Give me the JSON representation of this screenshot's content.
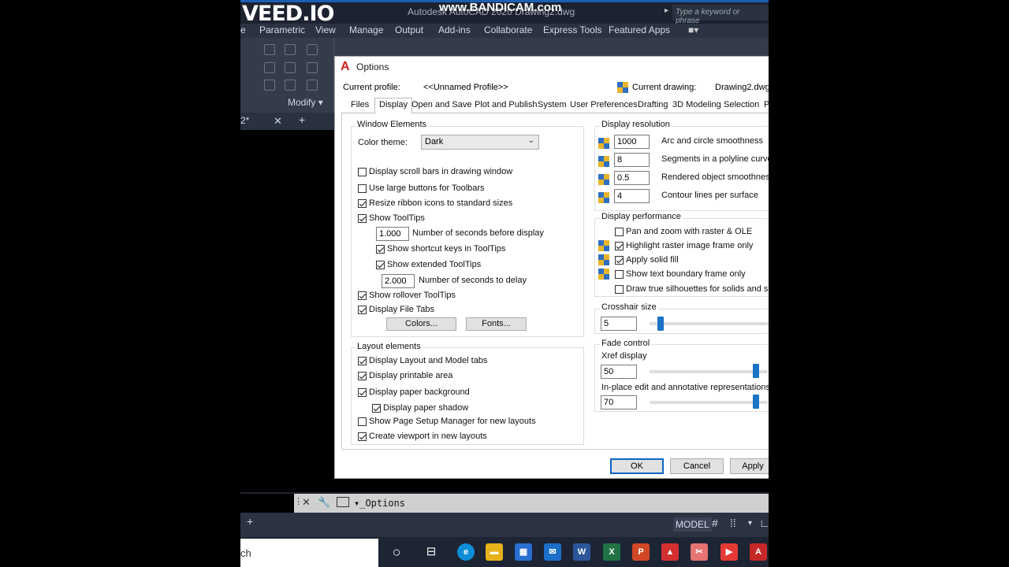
{
  "app": {
    "watermark": "VEED.IO",
    "window_title": "Autodesk AutoCAD 2020   Drawing2.dwg",
    "recorder": "www.BANDICAM.com",
    "search_placeholder": "Type a keyword or phrase",
    "menus": [
      "e",
      "Parametric",
      "View",
      "Manage",
      "Output",
      "Add-ins",
      "Collaborate",
      "Express Tools",
      "Featured Apps"
    ],
    "ribbon_panel": "Modify",
    "doc_tab": "2*",
    "command_text": "_Options",
    "status_model": "MODEL",
    "taskbar_search": "ch"
  },
  "dialog": {
    "title": "Options",
    "current_profile_label": "Current profile:",
    "current_profile_value": "<<Unnamed Profile>>",
    "current_drawing_label": "Current drawing:",
    "current_drawing_value": "Drawing2.dwg",
    "tabs": [
      "Files",
      "Display",
      "Open and Save",
      "Plot and Publish",
      "System",
      "User Preferences",
      "Drafting",
      "3D Modeling",
      "Selection",
      "P"
    ],
    "window_elements": {
      "label": "Window Elements",
      "color_theme_label": "Color theme:",
      "color_theme_value": "Dark",
      "scroll_bars": "Display scroll bars in drawing window",
      "large_buttons": "Use large buttons for Toolbars",
      "resize_ribbon": "Resize ribbon icons to standard sizes",
      "show_tooltips": "Show ToolTips",
      "tooltip_seconds_value": "1.000",
      "tooltip_seconds_label": "Number of seconds before display",
      "shortcut_keys": "Show shortcut keys in ToolTips",
      "extended_tooltips": "Show extended ToolTips",
      "delay_value": "2.000",
      "delay_label": "Number of seconds to delay",
      "rollover_tooltips": "Show rollover ToolTips",
      "file_tabs": "Display File Tabs",
      "colors_button": "Colors...",
      "fonts_button": "Fonts..."
    },
    "layout_elements": {
      "label": "Layout elements",
      "layout_model_tabs": "Display Layout and Model tabs",
      "printable_area": "Display printable area",
      "paper_background": "Display paper background",
      "paper_shadow": "Display paper shadow",
      "page_setup": "Show Page Setup Manager for new layouts",
      "create_viewport": "Create viewport in new layouts"
    },
    "display_resolution": {
      "label": "Display resolution",
      "arc_value": "1000",
      "arc_label": "Arc and circle smoothness",
      "seg_value": "8",
      "seg_label": "Segments in a polyline curve",
      "render_value": "0.5",
      "render_label": "Rendered object smoothness",
      "contour_value": "4",
      "contour_label": "Contour lines per surface"
    },
    "display_performance": {
      "label": "Display performance",
      "pan_zoom": "Pan and zoom with raster & OLE",
      "highlight_raster": "Highlight raster image frame only",
      "solid_fill": "Apply solid fill",
      "text_boundary": "Show text boundary frame only",
      "silhouettes": "Draw true silhouettes for solids and surfa"
    },
    "crosshair": {
      "label": "Crosshair size",
      "value": "5"
    },
    "fade": {
      "label": "Fade control",
      "xref_label": "Xref display",
      "xref_value": "50",
      "inplace_label": "In-place edit and annotative representations",
      "inplace_value": "70"
    },
    "buttons": {
      "ok": "OK",
      "cancel": "Cancel",
      "apply": "Apply"
    }
  }
}
